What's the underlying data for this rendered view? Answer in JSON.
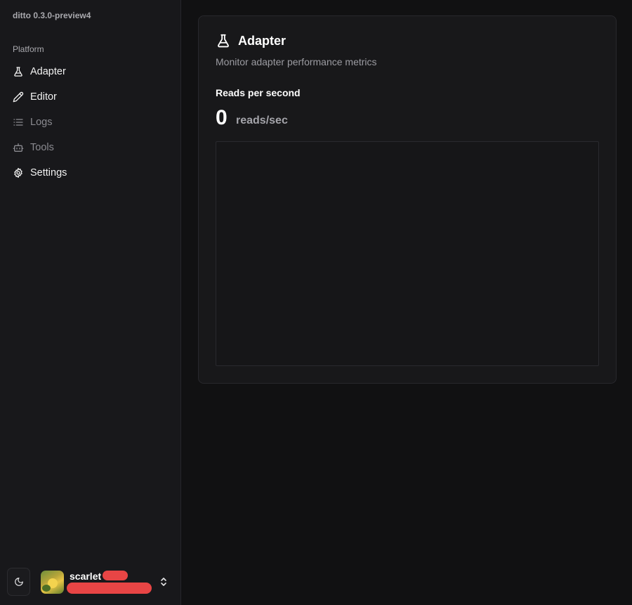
{
  "app": {
    "version": "ditto 0.3.0-preview4"
  },
  "sidebar": {
    "group_label": "Platform",
    "items": [
      {
        "label": "Adapter",
        "icon": "flask-icon",
        "enabled": true
      },
      {
        "label": "Editor",
        "icon": "pencil-icon",
        "enabled": true
      },
      {
        "label": "Logs",
        "icon": "list-icon",
        "enabled": false
      },
      {
        "label": "Tools",
        "icon": "bot-icon",
        "enabled": false
      },
      {
        "label": "Settings",
        "icon": "gear-icon",
        "enabled": true
      }
    ]
  },
  "footer": {
    "theme_icon": "moon-icon",
    "user": {
      "name": "scarlet",
      "menu_icon": "chevrons-up-down-icon"
    }
  },
  "card": {
    "title": "Adapter",
    "title_icon": "flask-icon",
    "subtitle": "Monitor adapter performance metrics",
    "metric": {
      "label": "Reads per second",
      "value": "0",
      "unit": "reads/sec"
    }
  },
  "colors": {
    "background": "#111112",
    "sidebar": "#18181b",
    "card": "#18181a",
    "redaction": "#e84545"
  }
}
